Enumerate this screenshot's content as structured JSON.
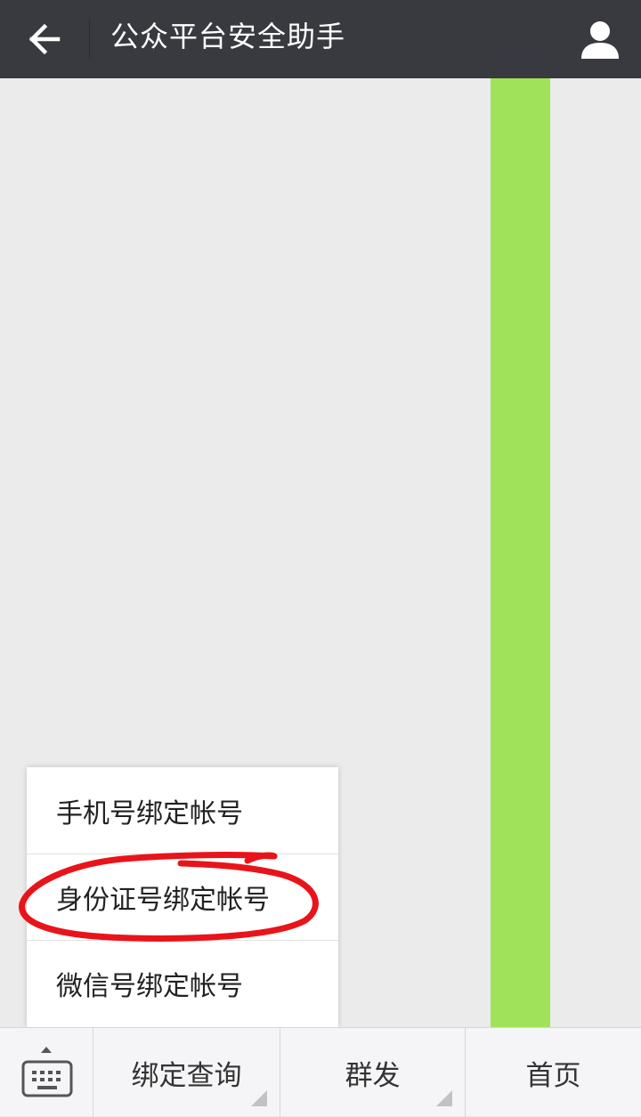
{
  "header": {
    "title": "公众平台安全助手",
    "back_icon": "arrow-left-icon",
    "profile_icon": "person-icon",
    "background_color": "#393a3f"
  },
  "content": {
    "accent_bar_color": "#a0e35a"
  },
  "popup_menu": {
    "items": [
      {
        "label": "手机号绑定帐号"
      },
      {
        "label": "身份证号绑定帐号",
        "highlighted": true
      },
      {
        "label": "微信号绑定帐号"
      }
    ],
    "highlight_color": "#e8141a"
  },
  "bottom_menu": {
    "keyboard_icon": "keyboard-icon",
    "tabs": [
      {
        "label": "绑定查询",
        "has_submenu": true
      },
      {
        "label": "群发",
        "has_submenu": true
      },
      {
        "label": "首页",
        "has_submenu": false
      }
    ]
  }
}
